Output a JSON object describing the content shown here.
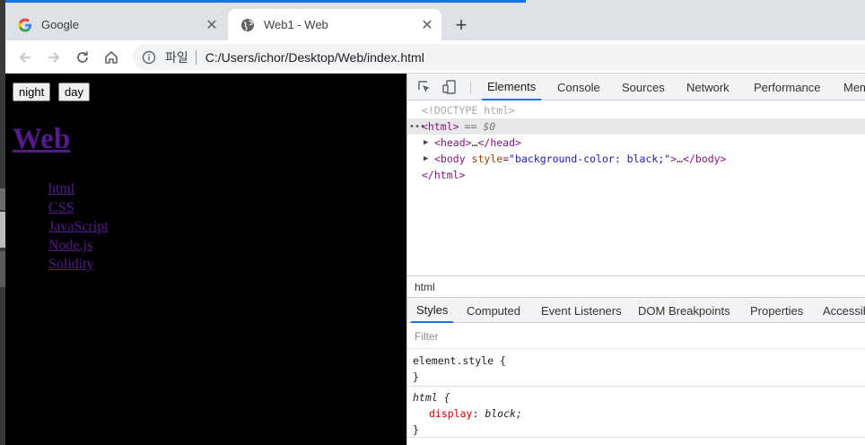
{
  "browser": {
    "tabs": [
      {
        "title": "Google",
        "favicon": "google-logo-icon",
        "active": false
      },
      {
        "title": "Web1 - Web",
        "favicon": "globe-icon",
        "active": true
      }
    ],
    "new_tab_symbol": "+",
    "close_symbol": "✕",
    "omnibox": {
      "scheme_label": "파일",
      "url": "C:/Users/ichor/Desktop/Web/index.html"
    },
    "accent_color": "#1a73e8"
  },
  "page": {
    "background": "#000000",
    "buttons": [
      {
        "label": "night"
      },
      {
        "label": "day"
      }
    ],
    "heading": "Web",
    "links": [
      "html",
      "CSS",
      "JavaScript",
      "Node.js",
      "Solidity"
    ],
    "link_color": "#551a8b"
  },
  "devtools": {
    "tabs": [
      "Elements",
      "Console",
      "Sources",
      "Network",
      "Performance",
      "Mem"
    ],
    "active_tab": "Elements",
    "dom": {
      "doctype": "<!DOCTYPE html>",
      "html_open": "<html>",
      "selected_marker": "== $0",
      "head": {
        "open": "<head>",
        "ellipsis": "…",
        "close": "</head>"
      },
      "body": {
        "open": "<body",
        "attr_name": "style",
        "attr_value": "\"background-color: black;\"",
        "close_open": ">",
        "ellipsis": "…",
        "close": "</body>"
      },
      "html_close": "</html>"
    },
    "breadcrumb": "html",
    "styles_tabs": [
      "Styles",
      "Computed",
      "Event Listeners",
      "DOM Breakpoints",
      "Properties",
      "Accessib"
    ],
    "active_styles_tab": "Styles",
    "filter_placeholder": "Filter",
    "rules": [
      {
        "selector": "element.style {",
        "close": "}"
      },
      {
        "selector": "html {",
        "declaration_prop": "display",
        "declaration_value": "block;",
        "close": "}"
      }
    ]
  }
}
